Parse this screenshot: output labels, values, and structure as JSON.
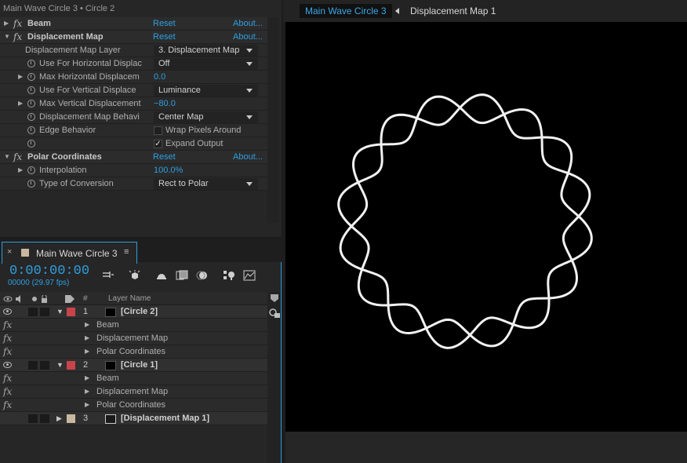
{
  "effect_controls": {
    "title": "Main Wave Circle 3 • Circle 2",
    "rows": [
      {
        "kind": "fx",
        "expanded": false,
        "name": "Beam",
        "reset": "Reset",
        "about": "About..."
      },
      {
        "kind": "fx",
        "expanded": true,
        "name": "Displacement Map",
        "reset": "Reset",
        "about": "About..."
      },
      {
        "kind": "dropdown",
        "stopwatch": false,
        "label": "Displacement Map Layer",
        "value": "3. Displacement Map"
      },
      {
        "kind": "dropdown",
        "stopwatch": true,
        "label": "Use For Horizontal Displac",
        "value": "Off"
      },
      {
        "kind": "value",
        "stopwatch": true,
        "twirl": true,
        "label": "Max Horizontal Displacem",
        "value": "0.0"
      },
      {
        "kind": "dropdown",
        "stopwatch": true,
        "label": "Use For Vertical Displace",
        "value": "Luminance"
      },
      {
        "kind": "value",
        "stopwatch": true,
        "twirl": true,
        "label": "Max Vertical Displacement",
        "value": "−80.0"
      },
      {
        "kind": "dropdown",
        "stopwatch": true,
        "label": "Displacement Map Behavi",
        "value": "Center Map"
      },
      {
        "kind": "checkbox",
        "stopwatch": true,
        "label": "Edge Behavior",
        "checked": false,
        "value": "Wrap Pixels Around"
      },
      {
        "kind": "checkbox",
        "stopwatch": true,
        "label": "",
        "checked": true,
        "value": "Expand Output"
      },
      {
        "kind": "fx",
        "expanded": true,
        "name": "Polar Coordinates",
        "reset": "Reset",
        "about": "About..."
      },
      {
        "kind": "value",
        "stopwatch": true,
        "twirl": true,
        "label": "Interpolation",
        "value": "100.0%"
      },
      {
        "kind": "dropdown",
        "stopwatch": true,
        "label": "Type of Conversion",
        "value": "Rect to Polar"
      }
    ],
    "check_mark": "✓"
  },
  "viewer": {
    "tabs": [
      "Main Wave Circle 3",
      "Displacement Map 1"
    ],
    "background": "#000000",
    "stroke_color": "#f2f2f2"
  },
  "timeline": {
    "tab_label": "Main Wave Circle 3",
    "close_glyph": "×",
    "menu_glyph": "≡",
    "timecode": "0:00:00:00",
    "fps": "00000 (29.97 fps)",
    "column_headers": {
      "number": "#",
      "layer_name": "Layer Name"
    },
    "layers": [
      {
        "number": "1",
        "name": "[Circle 2]",
        "label_color": "#c9444a",
        "type": "solid",
        "visible": true,
        "effects": [
          "Beam",
          "Displacement Map",
          "Polar Coordinates"
        ]
      },
      {
        "number": "2",
        "name": "[Circle 1]",
        "label_color": "#c9444a",
        "type": "solid",
        "visible": true,
        "effects": [
          "Beam",
          "Displacement Map",
          "Polar Coordinates"
        ]
      },
      {
        "number": "3",
        "name": "[Displacement Map 1]",
        "label_color": "#c9b8a1",
        "type": "comp",
        "visible": false,
        "effects": []
      }
    ],
    "fx_glyph": "fx"
  },
  "accent_color": "#2e9fe0"
}
